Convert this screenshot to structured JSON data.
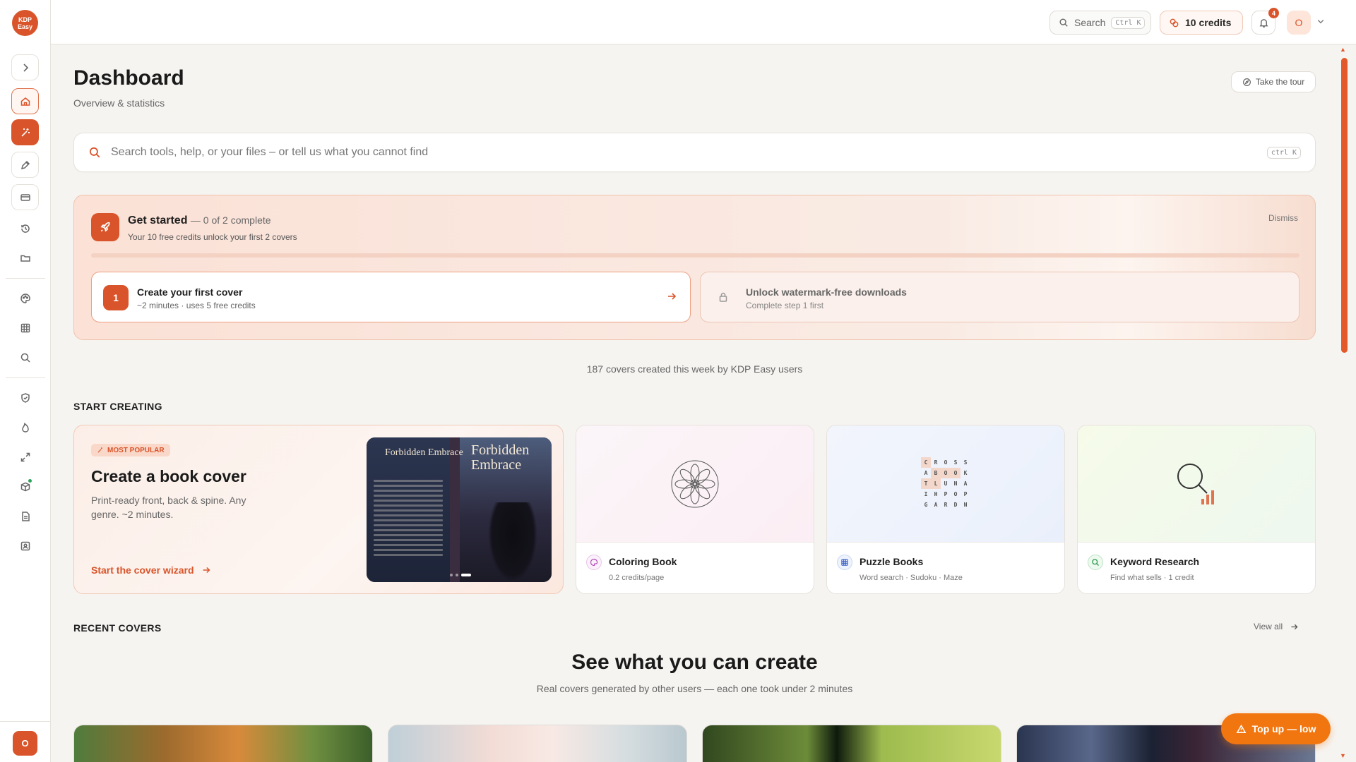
{
  "app": {
    "logo_text": "KDP Easy",
    "accent_color": "#d9542a"
  },
  "topbar": {
    "search_label": "Search",
    "search_shortcut": "Ctrl K",
    "credits_label": "10 credits",
    "notification_count": "4",
    "user_initial": "O"
  },
  "sidebar": {
    "items": [
      {
        "name": "expand",
        "icon": "chevron-right-icon"
      },
      {
        "name": "home",
        "icon": "home-icon"
      },
      {
        "name": "cover-wand",
        "icon": "magic-wand-icon"
      },
      {
        "name": "edit",
        "icon": "pen-icon"
      },
      {
        "name": "billing",
        "icon": "card-icon"
      },
      {
        "name": "history",
        "icon": "history-icon"
      },
      {
        "name": "files",
        "icon": "folder-icon"
      },
      {
        "name": "palette",
        "icon": "palette-icon"
      },
      {
        "name": "grid",
        "icon": "grid-icon"
      },
      {
        "name": "search",
        "icon": "search-icon"
      },
      {
        "name": "shield",
        "icon": "shield-icon"
      },
      {
        "name": "flame",
        "icon": "flame-icon"
      },
      {
        "name": "expand-arrows",
        "icon": "resize-icon"
      },
      {
        "name": "package",
        "icon": "box-icon"
      },
      {
        "name": "document",
        "icon": "document-icon"
      },
      {
        "name": "profile",
        "icon": "id-card-icon"
      }
    ],
    "user_initial": "O"
  },
  "dashboard": {
    "title": "Dashboard",
    "subtitle": "Overview & statistics",
    "tour_label": "Take the tour",
    "search_placeholder": "Search tools, help, or your files – or tell us what you cannot find",
    "search_shortcut": "ctrl K"
  },
  "get_started": {
    "title": "Get started",
    "count": "— 0 of 2 complete",
    "subtitle": "Your 10 free credits unlock your first 2 covers",
    "dismiss": "Dismiss",
    "progress_fraction": 0,
    "steps": [
      {
        "number": "1",
        "title": "Create your first cover",
        "sub": "~2 minutes · uses 5 free credits"
      },
      {
        "title": "Unlock watermark-free downloads",
        "sub": "Complete step 1 first"
      }
    ]
  },
  "week_stat": "187 covers created this week by KDP Easy users",
  "start_creating": {
    "heading": "START CREATING",
    "main_card": {
      "pill": "MOST POPULAR",
      "title": "Create a book cover",
      "desc": "Print-ready front, back & spine. Any genre. ~2 minutes.",
      "link": "Start the cover wizard",
      "cover_title_back": "Forbidden Embrace",
      "cover_title_front": "Forbidden Embrace"
    },
    "tools": [
      {
        "name": "Coloring Book",
        "sub": "0.2 credits/page",
        "icon": "palette-icon"
      },
      {
        "name": "Puzzle Books",
        "sub": "Word search · Sudoku · Maze",
        "icon": "grid-icon"
      },
      {
        "name": "Keyword Research",
        "sub": "Find what sells · 1 credit",
        "icon": "search-icon"
      }
    ],
    "puzzle_letters": [
      "C",
      "R",
      "O",
      "S",
      "S",
      "A",
      "B",
      "O",
      "O",
      "K",
      "T",
      "L",
      "U",
      "N",
      "A",
      "I",
      "H",
      "P",
      "O",
      "P",
      "G",
      "A",
      "R",
      "D",
      "N"
    ]
  },
  "recent_covers": {
    "heading": "RECENT COVERS",
    "view_all": "View all",
    "showcase_title": "See what you can create",
    "showcase_sub": "Real covers generated by other users — each one took under 2 minutes"
  },
  "topup_label": "Top up — low"
}
